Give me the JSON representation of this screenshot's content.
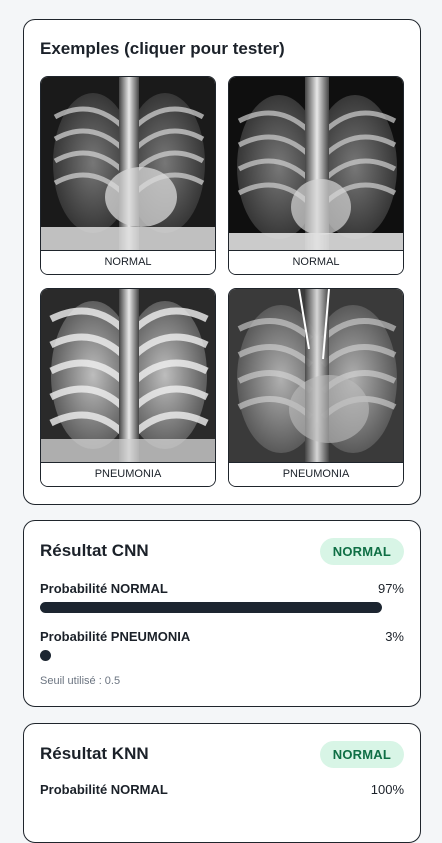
{
  "examples": {
    "title": "Exemples (cliquer pour tester)",
    "items": [
      {
        "label": "NORMAL"
      },
      {
        "label": "NORMAL"
      },
      {
        "label": "PNEUMONIA"
      },
      {
        "label": "PNEUMONIA"
      }
    ]
  },
  "cnn": {
    "title": "Résultat CNN",
    "badge": "NORMAL",
    "normal_label": "Probabilité NORMAL",
    "normal_value": "97%",
    "normal_fraction": 0.97,
    "pneumonia_label": "Probabilité PNEUMONIA",
    "pneumonia_value": "3%",
    "pneumonia_fraction": 0.03,
    "threshold": "Seuil utilisé : 0.5"
  },
  "knn": {
    "title": "Résultat KNN",
    "badge": "NORMAL",
    "normal_label": "Probabilité NORMAL",
    "normal_value": "100%"
  },
  "colors": {
    "badge_bg": "#d8f5e6",
    "badge_text": "#0f6f45",
    "bar": "#1c2530"
  }
}
